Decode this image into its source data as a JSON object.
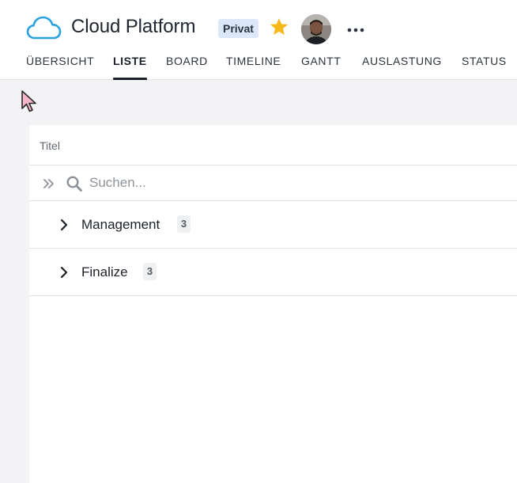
{
  "project": {
    "title": "Cloud Platform",
    "privacy": "Privat",
    "icon": "cloud-icon",
    "favorite": true
  },
  "tabs": [
    {
      "label": "ÜBERSICHT",
      "active": false
    },
    {
      "label": "LISTE",
      "active": true
    },
    {
      "label": "BOARD",
      "active": false
    },
    {
      "label": "TIMELINE",
      "active": false
    },
    {
      "label": "GANTT",
      "active": false
    },
    {
      "label": "AUSLASTUNG",
      "active": false
    },
    {
      "label": "STATUS",
      "active": false
    }
  ],
  "list": {
    "column_title": "Titel",
    "search_placeholder": "Suchen...",
    "groups": [
      {
        "label": "Management",
        "count": "3"
      },
      {
        "label": "Finalize",
        "count": "3"
      }
    ]
  },
  "colors": {
    "accent": "#1b2028",
    "cloud": "#2aa1e0",
    "star": "#f6b81b",
    "badge_bg": "#dce8f7"
  }
}
